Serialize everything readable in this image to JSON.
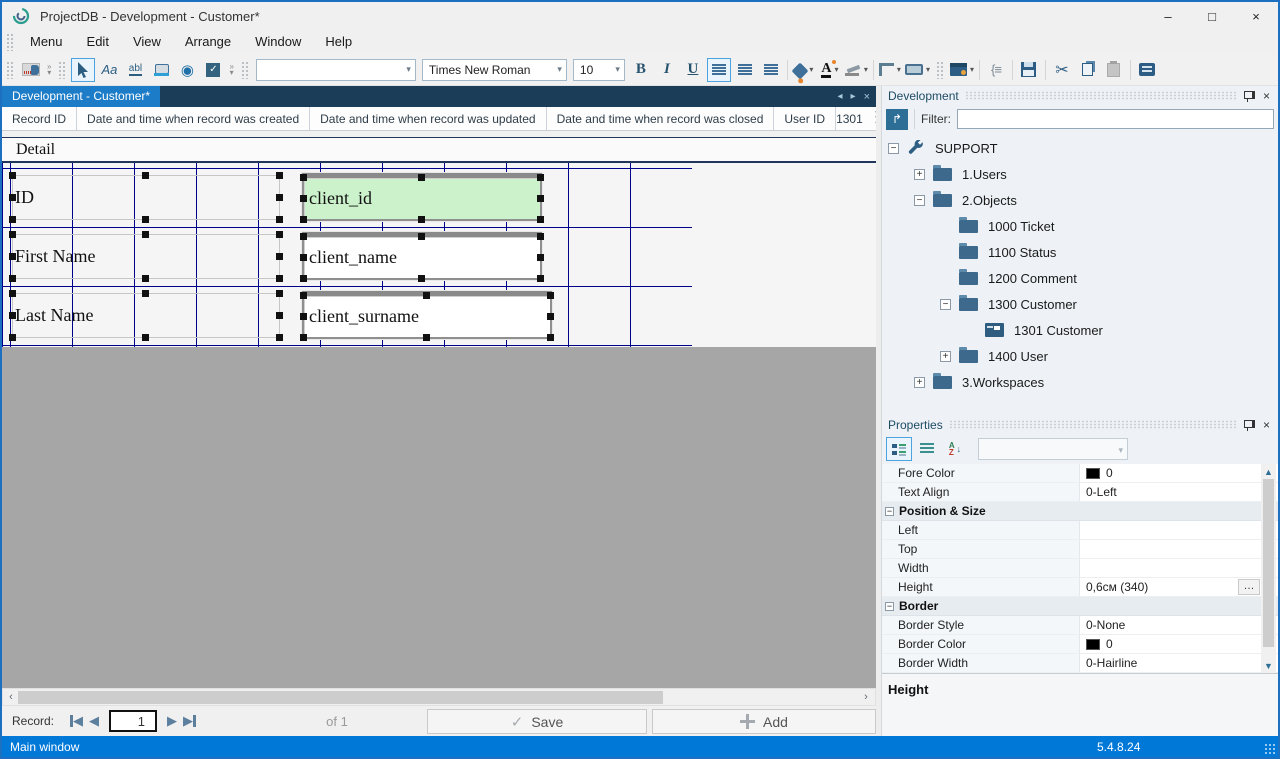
{
  "window": {
    "title": "ProjectDB - Development - Customer*"
  },
  "menu": {
    "items": [
      "Menu",
      "Edit",
      "View",
      "Arrange",
      "Window",
      "Help"
    ]
  },
  "toolbar": {
    "bold_label": "B",
    "italic_label": "I",
    "underline_label": "U",
    "style_combo_value": "",
    "font_name": "Times New Roman",
    "font_size": "10"
  },
  "tabs": {
    "active": "Development - Customer*"
  },
  "record_header": {
    "cells": [
      "Record ID",
      "Date and time when record was created",
      "Date and time when record was updated",
      "Date and time when record was closed",
      "User ID"
    ],
    "value": "1301"
  },
  "designer": {
    "band_label": "Detail",
    "rows": [
      {
        "label": "ID",
        "field": "client_id"
      },
      {
        "label": "First Name",
        "field": "client_name"
      },
      {
        "label": "Last Name",
        "field": "client_surname"
      }
    ]
  },
  "record_bar": {
    "label": "Record:",
    "current": "1",
    "of_text": "of 1",
    "save_label": "Save",
    "add_label": "Add"
  },
  "dev_panel": {
    "title": "Development",
    "filter_label": "Filter:",
    "filter_value": "",
    "tree": [
      {
        "label": "SUPPORT",
        "expander": "−",
        "icon": "wrench"
      },
      {
        "label": "1.Users",
        "expander": "+",
        "icon": "folder"
      },
      {
        "label": "2.Objects",
        "expander": "−",
        "icon": "folder"
      },
      {
        "label": "1000 Ticket",
        "expander": "",
        "icon": "folder"
      },
      {
        "label": "1100 Status",
        "expander": "",
        "icon": "folder"
      },
      {
        "label": "1200 Comment",
        "expander": "",
        "icon": "folder"
      },
      {
        "label": "1300 Customer",
        "expander": "−",
        "icon": "folder"
      },
      {
        "label": "1301 Customer",
        "expander": "",
        "icon": "form"
      },
      {
        "label": "1400 User",
        "expander": "+",
        "icon": "folder"
      },
      {
        "label": "3.Workspaces",
        "expander": "+",
        "icon": "folder"
      }
    ]
  },
  "properties": {
    "title": "Properties",
    "ellipsis_label": "…",
    "rows": [
      {
        "name": "Fore Color",
        "value": "0"
      },
      {
        "name": "Text Align",
        "value": "0-Left"
      },
      {
        "name": "Position & Size"
      },
      {
        "name": "Left",
        "value": ""
      },
      {
        "name": "Top",
        "value": ""
      },
      {
        "name": "Width",
        "value": ""
      },
      {
        "name": "Height",
        "value": "0,6см (340)"
      },
      {
        "name": "Border"
      },
      {
        "name": "Border Style",
        "value": "0-None"
      },
      {
        "name": "Border Color",
        "value": "0"
      },
      {
        "name": "Border Width",
        "value": "0-Hairline"
      }
    ],
    "description": "Height"
  },
  "status_bar": {
    "left": "Main window",
    "version": "5.4.8.24"
  },
  "colors": {
    "accent": "#0078d7",
    "tab_active": "#1c7cc7",
    "grid_line": "#00008b",
    "field_highlight": "#ccf2cc",
    "icon_steel": "#356a93"
  }
}
